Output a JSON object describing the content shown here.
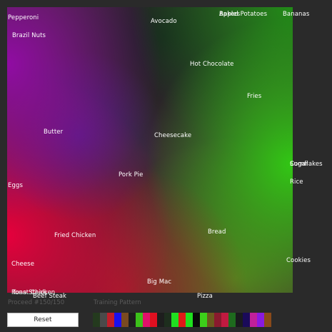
{
  "labels": [
    {
      "id": "pepperoni",
      "text": "Pepperoni"
    },
    {
      "id": "brazil-nuts",
      "text": "Brazil Nuts"
    },
    {
      "id": "avocado",
      "text": "Avocado"
    },
    {
      "id": "apples",
      "text": "Apples"
    },
    {
      "id": "baked-potatoes",
      "text": "Baked Potatoes"
    },
    {
      "id": "bananas",
      "text": "Bananas"
    },
    {
      "id": "hot-chocolate",
      "text": "Hot Chocolate"
    },
    {
      "id": "fries",
      "text": "Fries"
    },
    {
      "id": "butter",
      "text": "Butter"
    },
    {
      "id": "cheesecake",
      "text": "Cheesecake"
    },
    {
      "id": "pork-pie",
      "text": "Pork Pie"
    },
    {
      "id": "cornflakes",
      "text": "Cornflakes"
    },
    {
      "id": "sugar",
      "text": "Sugar"
    },
    {
      "id": "rice",
      "text": "Rice"
    },
    {
      "id": "eggs",
      "text": "Eggs"
    },
    {
      "id": "fried-chicken",
      "text": "Fried Chicken"
    },
    {
      "id": "bread",
      "text": "Bread"
    },
    {
      "id": "cookies",
      "text": "Cookies"
    },
    {
      "id": "cheese",
      "text": "Cheese"
    },
    {
      "id": "big-mac",
      "text": "Big Mac"
    },
    {
      "id": "roast-chicken",
      "text": "Roast Chicken"
    },
    {
      "id": "tuna-steak",
      "text": "Tuna Steak"
    },
    {
      "id": "beef-steak",
      "text": "Beef Steak"
    },
    {
      "id": "pizza",
      "text": "Pizza"
    }
  ],
  "status": {
    "progress_label": "Proceed #150/150",
    "pattern_label": "Training Pattern"
  },
  "controls": {
    "reset_label": "Reset"
  },
  "training_pattern": [
    "#243a1e",
    "#4a4a4a",
    "#c01e2a",
    "#1a10ee",
    "#7a4a20",
    "#1e1e1e",
    "#3cc01a",
    "#e0106a",
    "#e01020",
    "#1e1e1e",
    "#1e2e1e",
    "#20e020",
    "#e01818",
    "#1ee01e",
    "#0a0a0a",
    "#3cd01a",
    "#6a5a1e",
    "#8a1a2e",
    "#c01a40",
    "#1e6a1e",
    "#1a1a1e",
    "#1a0a5a",
    "#c0209a",
    "#8a1ae0",
    "#8a4a1a"
  ]
}
